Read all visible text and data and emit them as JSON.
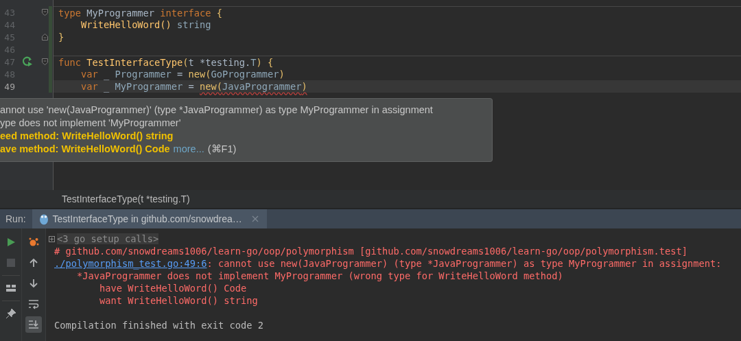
{
  "editor": {
    "lines": [
      {
        "number": "43",
        "current": false,
        "separator": true,
        "fold": {
          "kind": "start"
        },
        "tokens": [
          {
            "text": "type ",
            "kind": "keyword"
          },
          {
            "text": "MyProgrammer ",
            "kind": "plain"
          },
          {
            "text": "interface ",
            "kind": "keyword"
          },
          {
            "text": "{",
            "kind": "brace"
          }
        ]
      },
      {
        "number": "44",
        "current": false,
        "separator": false,
        "tokens": [
          {
            "text": "    WriteHelloWord() ",
            "kind": "func"
          },
          {
            "text": "string",
            "kind": "typeref"
          }
        ]
      },
      {
        "number": "45",
        "current": false,
        "separator": false,
        "fold": {
          "kind": "end"
        },
        "tokens": [
          {
            "text": "}",
            "kind": "brace"
          }
        ]
      },
      {
        "number": "46",
        "current": false,
        "separator": false
      },
      {
        "number": "47",
        "current": false,
        "separator": true,
        "gutter": {
          "kind": "run"
        },
        "fold": {
          "kind": "start"
        },
        "tokens": [
          {
            "text": "func ",
            "kind": "keyword"
          },
          {
            "text": "TestInterfaceType",
            "kind": "func"
          },
          {
            "text": "(",
            "kind": "brace"
          },
          {
            "text": "t *testing.",
            "kind": "plain"
          },
          {
            "text": "T",
            "kind": "typeref"
          },
          {
            "text": ") {",
            "kind": "brace"
          }
        ]
      },
      {
        "number": "48",
        "current": false,
        "separator": false,
        "tokens": [
          {
            "text": "    var ",
            "kind": "keyword"
          },
          {
            "text": "_ ",
            "kind": "plain"
          },
          {
            "text": "Programmer ",
            "kind": "typeref"
          },
          {
            "text": "= ",
            "kind": "plain"
          },
          {
            "text": "new(",
            "kind": "brace"
          },
          {
            "text": "GoProgrammer",
            "kind": "typeref"
          },
          {
            "text": ")",
            "kind": "brace"
          }
        ]
      },
      {
        "number": "49",
        "current": true,
        "separator": false,
        "tokens": [
          {
            "text": "    var ",
            "kind": "keyword"
          },
          {
            "text": "_ ",
            "kind": "plain"
          },
          {
            "text": "MyProgrammer ",
            "kind": "typeref"
          },
          {
            "text": "= ",
            "kind": "plain"
          },
          {
            "kind": "error",
            "children": [
              {
                "text": "new(",
                "kind": "brace"
              },
              {
                "text": "JavaProgrammer",
                "kind": "typeref"
              },
              {
                "text": ")",
                "kind": "brace"
              }
            ]
          }
        ]
      }
    ]
  },
  "tooltip": {
    "lines": [
      {
        "kind": "plain",
        "text": "annot use 'new(JavaProgrammer)' (type *JavaProgrammer) as type MyProgrammer in assignment"
      },
      {
        "kind": "plain",
        "text": "ype does not implement 'MyProgrammer'"
      },
      {
        "kind": "bold",
        "text": "eed method: WriteHelloWord() string"
      },
      {
        "kind": "bold",
        "text": "ave method: WriteHelloWord() Code",
        "link": "more...",
        "shortcut": "(⌘F1)"
      }
    ]
  },
  "breadcrumb": "TestInterfaceType(t *testing.T)",
  "run": {
    "label": "Run:",
    "tabs": [
      {
        "title": "TestInterfaceType in github.com/snowdrea…",
        "selected": true
      }
    ],
    "toolbar_left": [
      {
        "kind": "run",
        "disabled": false
      },
      {
        "kind": "stop",
        "disabled": true
      },
      {
        "kind": "layout",
        "disabled": false
      },
      {
        "kind": "pin",
        "disabled": false
      }
    ],
    "toolbar_right": [
      {
        "kind": "debug",
        "selected": false
      },
      {
        "kind": "up",
        "selected": false
      },
      {
        "kind": "down",
        "selected": false
      },
      {
        "kind": "wrap",
        "selected": false
      },
      {
        "kind": "scroll-end",
        "selected": true
      }
    ],
    "console": [
      {
        "kind": "folded",
        "segments": [
          {
            "text": "<3 go setup calls>",
            "kind": "muted"
          }
        ]
      },
      {
        "kind": "line",
        "segments": [
          {
            "text": "# github.com/snowdreams1006/learn-go/oop/polymorphism [github.com/snowdreams1006/learn-go/oop/polymorphism.test]",
            "kind": "error"
          }
        ]
      },
      {
        "kind": "line",
        "segments": [
          {
            "text": "./polymorphism_test.go:49:6",
            "kind": "link"
          },
          {
            "text": ": cannot use new(JavaProgrammer) (type *JavaProgrammer) as type MyProgrammer in assignment:",
            "kind": "error"
          }
        ]
      },
      {
        "kind": "line",
        "segments": [
          {
            "text": "    *JavaProgrammer does not implement MyProgrammer (wrong type for WriteHelloWord method)",
            "kind": "error"
          }
        ]
      },
      {
        "kind": "line",
        "segments": [
          {
            "text": "        have WriteHelloWord() Code",
            "kind": "error"
          }
        ]
      },
      {
        "kind": "line",
        "segments": [
          {
            "text": "        want WriteHelloWord() string",
            "kind": "error"
          }
        ]
      },
      {
        "kind": "blank"
      },
      {
        "kind": "line",
        "segments": [
          {
            "text": "Compilation finished with exit code 2",
            "kind": "plain"
          }
        ]
      }
    ]
  }
}
